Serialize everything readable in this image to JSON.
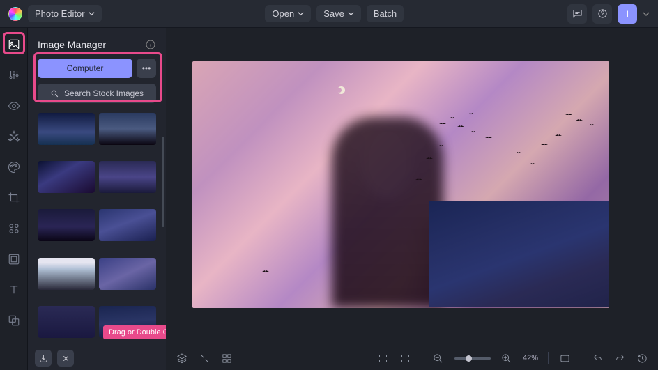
{
  "header": {
    "app_dropdown": "Photo Editor",
    "open": "Open",
    "save": "Save",
    "batch": "Batch",
    "avatar_initial": "I"
  },
  "panel": {
    "title": "Image Manager",
    "computer_btn": "Computer",
    "more_btn": "•••",
    "search_btn": "Search Stock Images",
    "tooltip": "Drag or Double Click"
  },
  "rail_icons": [
    "image-icon",
    "adjustments-icon",
    "eye-icon",
    "effects-icon",
    "palette-icon",
    "crop-icon",
    "elements-icon",
    "frame-icon",
    "text-icon",
    "layers-icon"
  ],
  "thumbnails": [
    {
      "gradient": "linear-gradient(180deg,#101a40,#3a4a80 60%,#153050)"
    },
    {
      "gradient": "linear-gradient(180deg,#2a3a60,#4a5a80 50%,#0a0510)"
    },
    {
      "gradient": "linear-gradient(150deg,#0a1030,#3a3a80 40%,#1a0a30)"
    },
    {
      "gradient": "linear-gradient(180deg,#2a2a55,#4a4588 50%,#1a1a3a)"
    },
    {
      "gradient": "linear-gradient(180deg,#1a1a3a,#2a2555 55%,#0a0515)"
    },
    {
      "gradient": "linear-gradient(160deg,#2a3570,#4a5095 45%,#1a2050)"
    },
    {
      "gradient": "linear-gradient(180deg,#e5e5f0 15%,#b0c0d5 35%,#2a2a3a)"
    },
    {
      "gradient": "linear-gradient(155deg,#3a4085,#6a65a5 50%,#2a3268)"
    },
    {
      "gradient": "linear-gradient(180deg,#2a2a55,#1a1840)"
    },
    {
      "gradient": "linear-gradient(175deg,#1a2550,#2a3565 50%,#10183a)"
    }
  ],
  "birds": [
    {
      "l": 354,
      "t": 88
    },
    {
      "l": 368,
      "t": 80
    },
    {
      "l": 380,
      "t": 92
    },
    {
      "l": 395,
      "t": 74
    },
    {
      "l": 398,
      "t": 100
    },
    {
      "l": 420,
      "t": 108
    },
    {
      "l": 352,
      "t": 120
    },
    {
      "l": 335,
      "t": 138
    },
    {
      "l": 320,
      "t": 168
    },
    {
      "l": 535,
      "t": 75
    },
    {
      "l": 550,
      "t": 83
    },
    {
      "l": 568,
      "t": 90
    },
    {
      "l": 520,
      "t": 105
    },
    {
      "l": 500,
      "t": 118
    },
    {
      "l": 463,
      "t": 130
    },
    {
      "l": 483,
      "t": 146
    },
    {
      "l": 370,
      "t": 215
    },
    {
      "l": 100,
      "t": 300
    }
  ],
  "zoom": {
    "percent": "42%"
  }
}
